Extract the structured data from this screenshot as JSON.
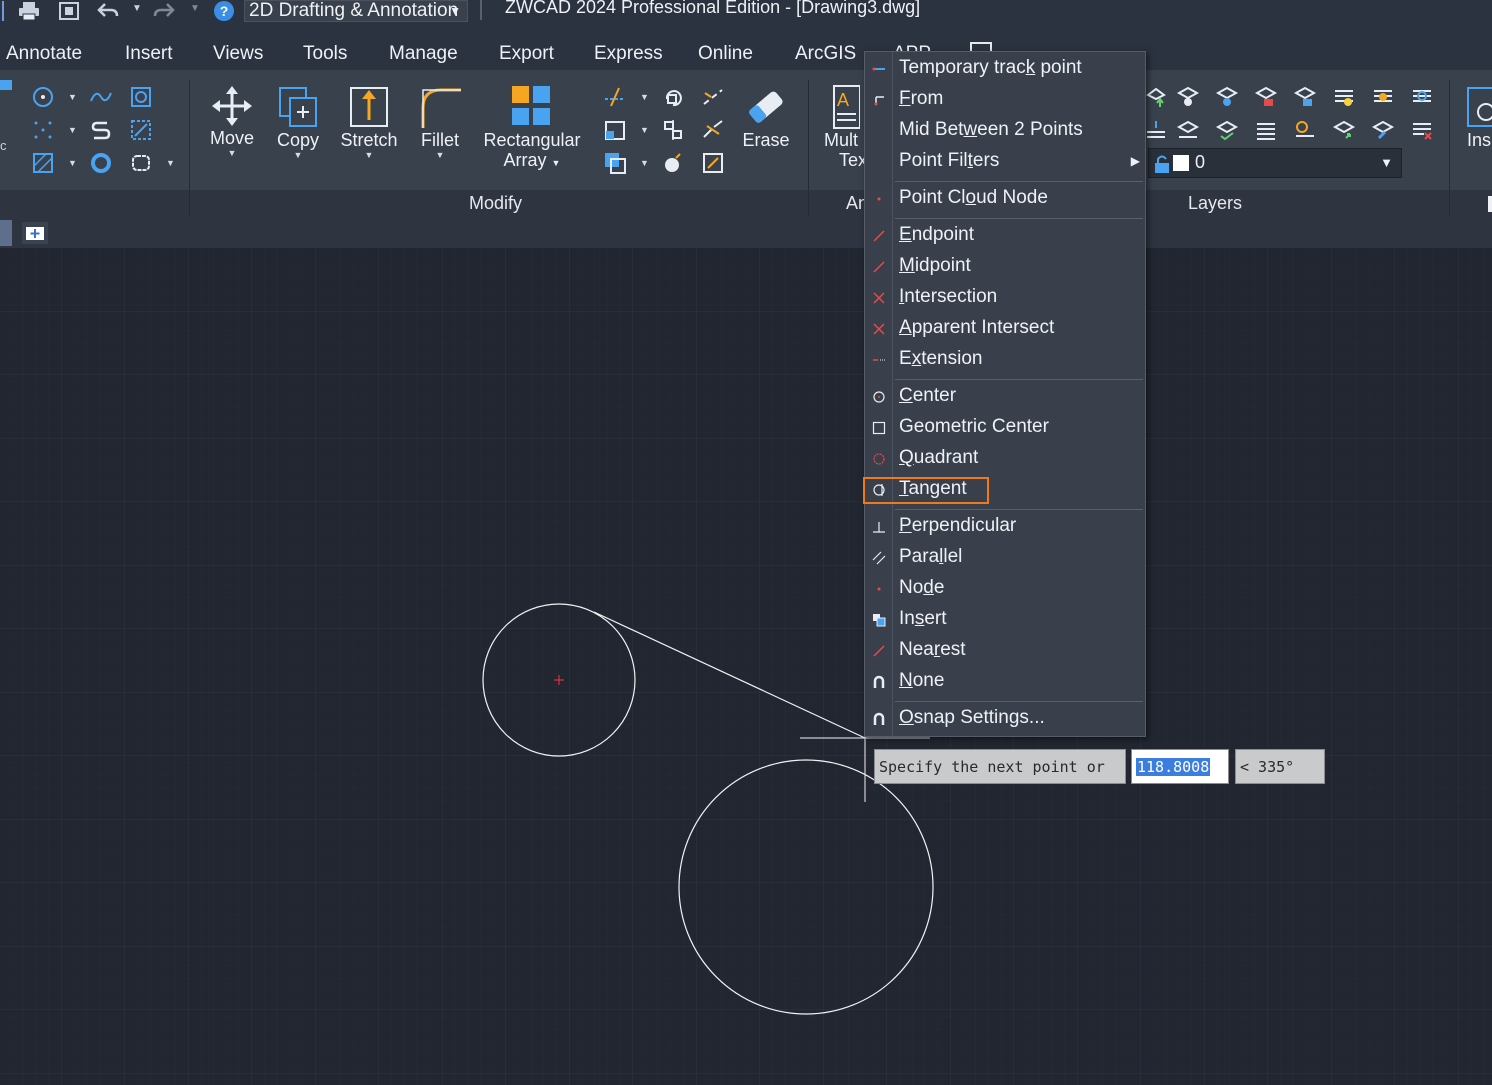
{
  "titlebar": {
    "workspace": "2D Drafting & Annotation",
    "title": "ZWCAD 2024 Professional Edition - [Drawing3.dwg]",
    "icons": [
      "print-icon",
      "plot-icon",
      "undo-icon",
      "redo-icon",
      "help-icon"
    ]
  },
  "menubar": {
    "items": [
      "Annotate",
      "Insert",
      "Views",
      "Tools",
      "Manage",
      "Export",
      "Express",
      "Online",
      "ArcGIS",
      "APP"
    ]
  },
  "ribbon": {
    "modify": {
      "title": "Modify",
      "move": "Move",
      "copy": "Copy",
      "stretch": "Stretch",
      "fillet": "Fillet",
      "array_line1": "Rectangular",
      "array_line2": "Array",
      "erase": "Erase"
    },
    "annotation": {
      "title": "An",
      "mtext_line1": "Mult",
      "mtext_line2": "Tex"
    },
    "layers": {
      "title": "Layers",
      "current_layer": "0"
    },
    "insert": {
      "label": "Ins"
    }
  },
  "osnap_menu": {
    "items": {
      "temporary_track_point": [
        "Temporary trac",
        "k",
        " point"
      ],
      "from": [
        "",
        "F",
        "rom"
      ],
      "mid_between": [
        "Mid Bet",
        "w",
        "een 2 Points"
      ],
      "point_filters": [
        "Point Fil",
        "t",
        "ers"
      ],
      "point_cloud_node": [
        "Point Cl",
        "o",
        "ud Node"
      ],
      "endpoint": [
        "",
        "E",
        "ndpoint"
      ],
      "midpoint": [
        "",
        "M",
        "idpoint"
      ],
      "intersection": [
        "",
        "I",
        "ntersection"
      ],
      "apparent_intersect": [
        "",
        "A",
        "pparent Intersect"
      ],
      "extension": [
        "E",
        "x",
        "tension"
      ],
      "center": [
        "",
        "C",
        "enter"
      ],
      "geometric_center": [
        "Geometric Center",
        "",
        ""
      ],
      "quadrant": [
        "",
        "Q",
        "uadrant"
      ],
      "tangent": [
        "",
        "T",
        "angent"
      ],
      "perpendicular": [
        "",
        "P",
        "erpendicular"
      ],
      "parallel": [
        "Para",
        "l",
        "lel"
      ],
      "node": [
        "No",
        "d",
        "e"
      ],
      "insert": [
        "In",
        "s",
        "ert"
      ],
      "nearest": [
        "Nea",
        "r",
        "est"
      ],
      "none": [
        "",
        "N",
        "one"
      ],
      "osnap_settings": [
        "",
        "O",
        "snap Settings..."
      ]
    }
  },
  "dynamic_input": {
    "prompt": "Specify the next point or",
    "length": "118.8008",
    "angle": "< 335°"
  },
  "colors": {
    "background": "#212630",
    "ribbon": "#39414d",
    "highlight": "#f07a18",
    "accent_orange": "#f5a623",
    "accent_blue": "#4aa3f0"
  }
}
